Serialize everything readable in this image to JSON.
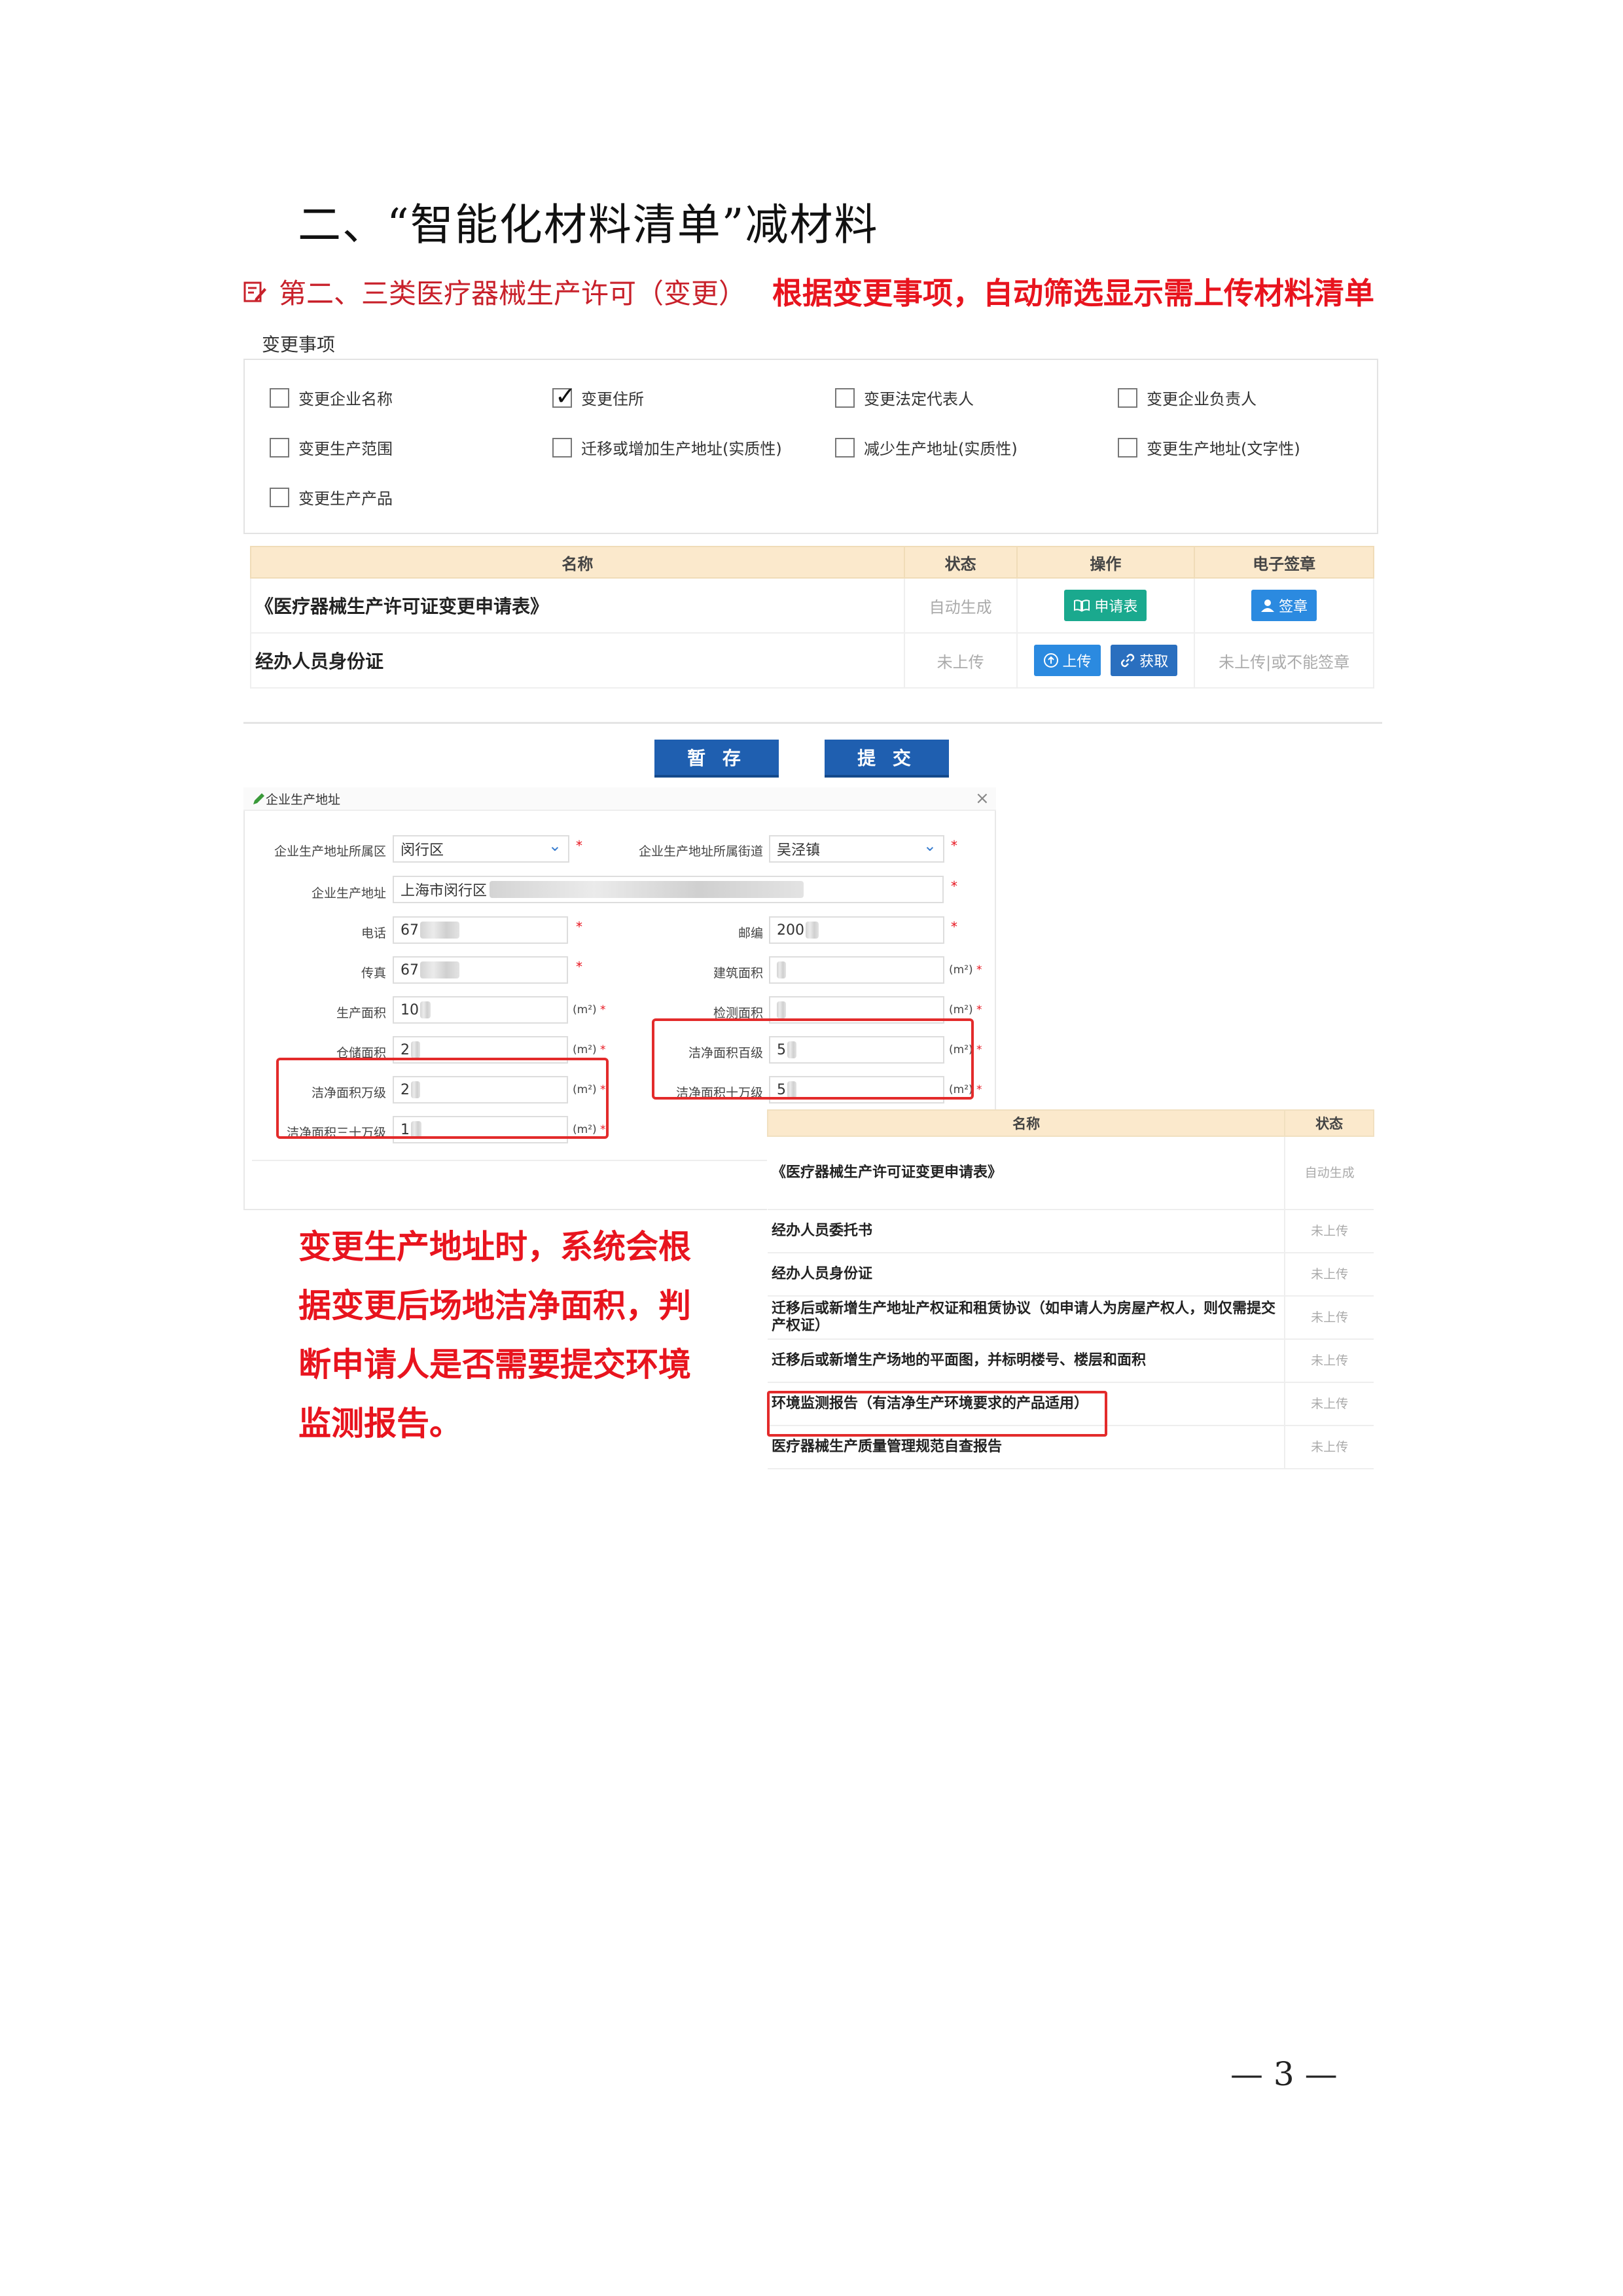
{
  "heading": "二、“智能化材料清单”减材料",
  "subtitle": "第二、三类医疗器械生产许可（变更）",
  "callout_top": "根据变更事项，自动筛选显示需上传材料清单",
  "change_items": {
    "label": "变更事项",
    "items": [
      {
        "label": "变更企业名称",
        "checked": false
      },
      {
        "label": "变更住所",
        "checked": true
      },
      {
        "label": "变更法定代表人",
        "checked": false
      },
      {
        "label": "变更企业负责人",
        "checked": false
      },
      {
        "label": "变更生产范围",
        "checked": false
      },
      {
        "label": "迁移或增加生产地址(实质性)",
        "checked": false
      },
      {
        "label": "减少生产地址(实质性)",
        "checked": false
      },
      {
        "label": "变更生产地址(文字性)",
        "checked": false
      },
      {
        "label": "变更生产产品",
        "checked": false
      }
    ]
  },
  "table1": {
    "headers": [
      "名称",
      "状态",
      "操作",
      "电子签章"
    ],
    "rows": [
      {
        "name": "《医疗器械生产许可证变更申请表》",
        "status": "自动生成",
        "actions": [
          "申请表"
        ],
        "signature": "签章"
      },
      {
        "name": "经办人员身份证",
        "status": "未上传",
        "actions": [
          "上传",
          "获取"
        ],
        "signature": "未上传|或不能签章"
      }
    ]
  },
  "buttons": {
    "save": "暂 存",
    "submit": "提 交"
  },
  "form": {
    "title": "企业生产地址",
    "close": "×",
    "fields": {
      "district_label": "企业生产地址所属区",
      "district_value": "闵行区",
      "street_label": "企业生产地址所属街道",
      "street_value": "吴泾镇",
      "address_label": "企业生产地址",
      "address_value": "上海市闵行区",
      "phone_label": "电话",
      "phone_value": "67",
      "postcode_label": "邮编",
      "postcode_value": "200",
      "fax_label": "传真",
      "fax_value": "67",
      "building_area_label": "建筑面积",
      "production_area_label": "生产面积",
      "production_area_value": "10",
      "inspection_area_label": "检测面积",
      "warehouse_area_label": "仓储面积",
      "warehouse_area_value": "2",
      "clean_100_label": "洁净面积百级",
      "clean_100_value": "5",
      "clean_10k_label": "洁净面积万级",
      "clean_10k_value": "2",
      "clean_100k_label": "洁净面积十万级",
      "clean_100k_value": "5",
      "clean_300k_label": "洁净面积三十万级",
      "clean_300k_value": "1"
    },
    "unit": "(m²)",
    "required_mark": "*"
  },
  "callout_bottom": "变更生产地址时，系统会根据变更后场地洁净面积，判断申请人是否需要提交环境监测报告。",
  "table2": {
    "headers": [
      "名称",
      "状态"
    ],
    "rows": [
      {
        "name": "《医疗器械生产许可证变更申请表》",
        "status": "自动生成"
      },
      {
        "name": "经办人员委托书",
        "status": "未上传"
      },
      {
        "name": "经办人员身份证",
        "status": "未上传"
      },
      {
        "name": "迁移后或新增生产地址产权证和租赁协议（如申请人为房屋产权人，则仅需提交产权证）",
        "status": "未上传"
      },
      {
        "name": "迁移后或新增生产场地的平面图，并标明楼号、楼层和面积",
        "status": "未上传"
      },
      {
        "name": "环境监测报告（有洁净生产环境要求的产品适用）",
        "status": "未上传"
      },
      {
        "name": "医疗器械生产质量管理规范自查报告",
        "status": "未上传"
      }
    ]
  },
  "page_number": "— 3 —",
  "colors": {
    "accent_red": "#e8141e",
    "table_header": "#fbe9cc",
    "button_blue": "#1f5fb0",
    "button_green": "#1aa98e"
  }
}
